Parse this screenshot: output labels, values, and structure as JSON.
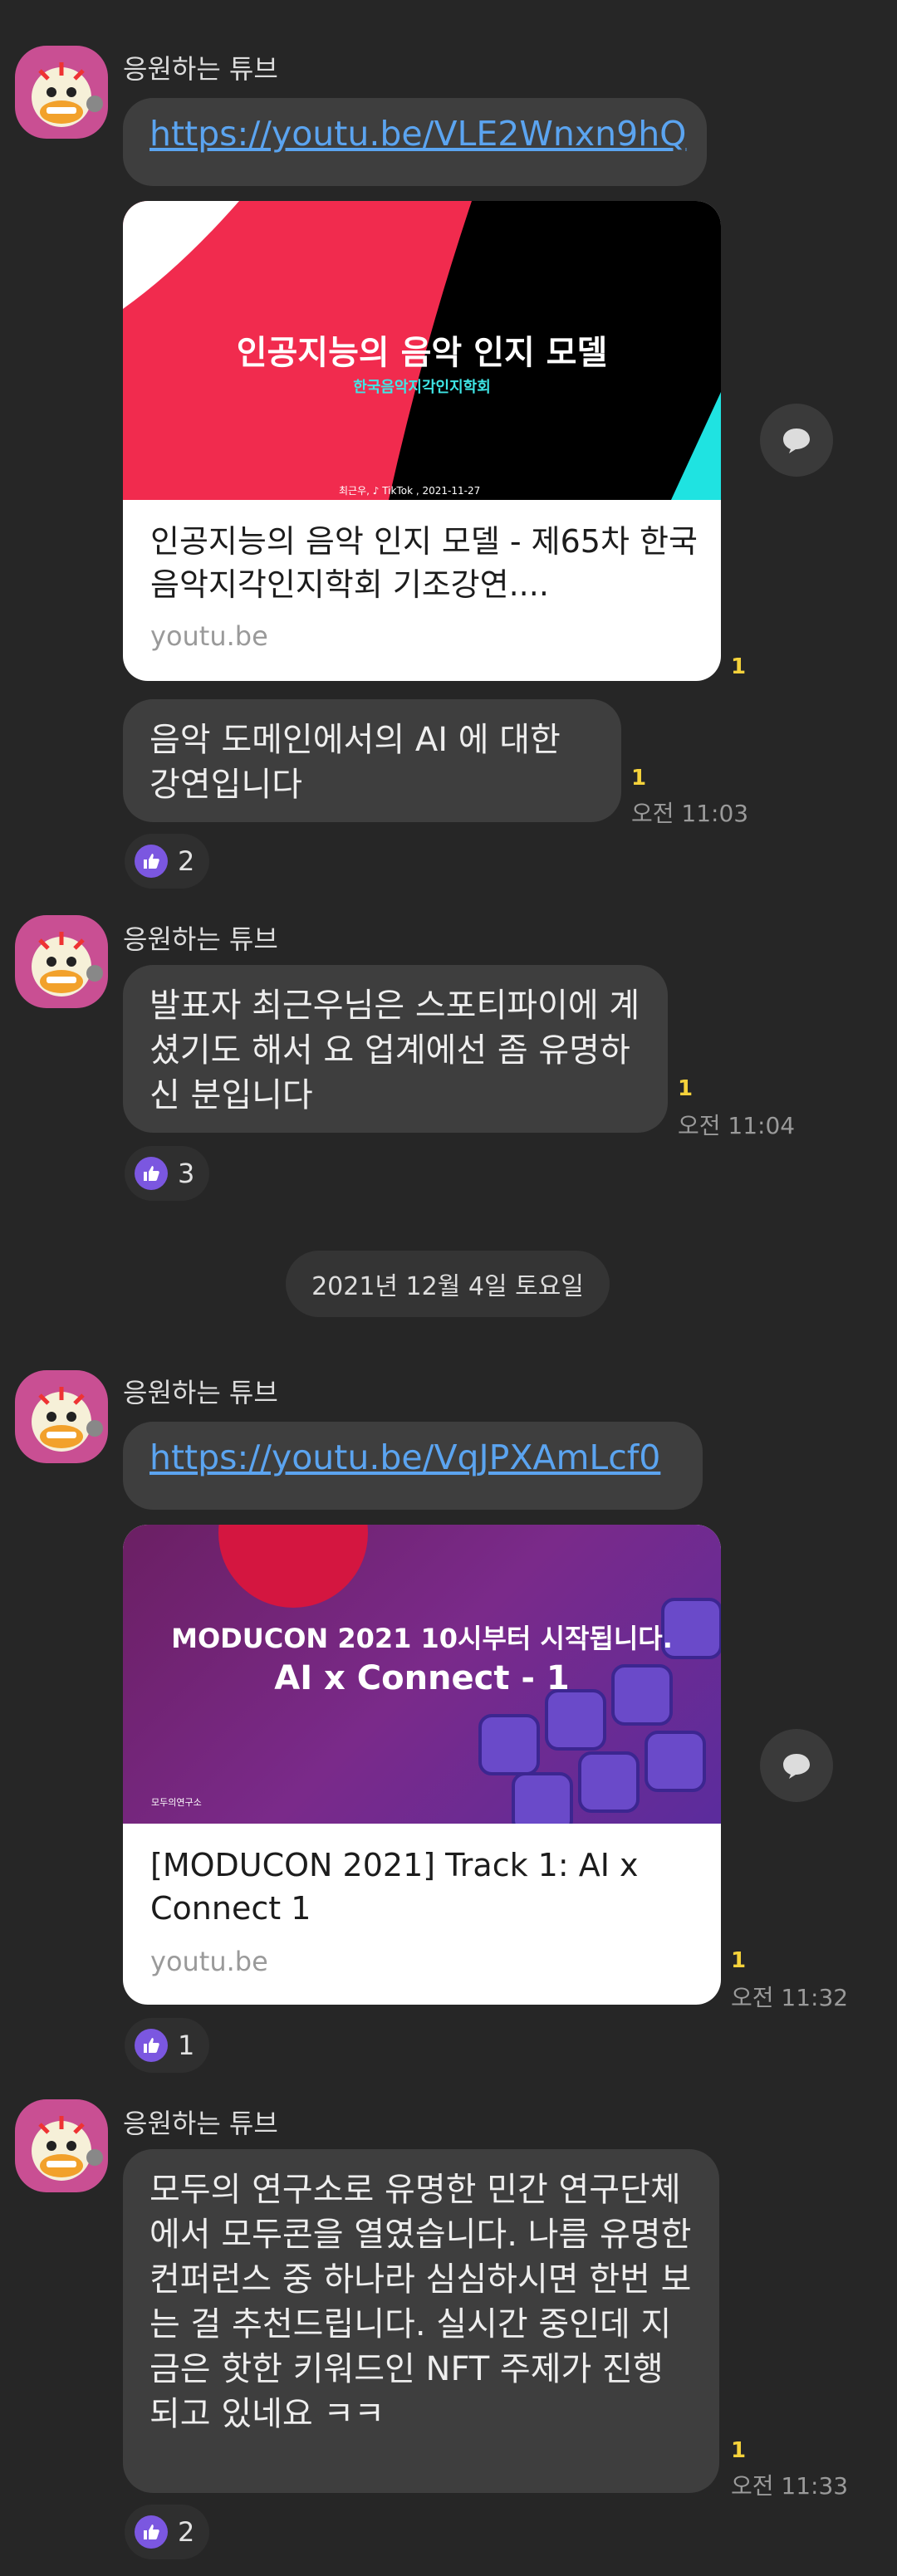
{
  "messages": [
    {
      "sender": "응원하는 튜브",
      "link": "https://youtu.be/VLE2Wnxn9hQ",
      "card": {
        "thumb_title": "인공지능의 음악 인지 모델",
        "thumb_subtitle": "한국음악지각인지학회",
        "thumb_footer": "최근우, ♪ TikTok , 2021-11-27",
        "title": "인공지능의 음악 인지 모델 - 제65차 한국음악지각인지학회 기조강연....",
        "domain": "youtu.be",
        "unread": "1"
      },
      "text": "음악 도메인에서의 AI 에 대한 강연입니다",
      "unread": "1",
      "time": "오전 11:03",
      "reaction": "2"
    },
    {
      "sender": "응원하는 튜브",
      "text": "발표자 최근우님은 스포티파이에 계셨기도 해서 요 업계에선 좀 유명하신 분입니다",
      "unread": "1",
      "time": "오전 11:04",
      "reaction": "3"
    },
    {
      "date_divider": "2021년 12월 4일 토요일"
    },
    {
      "sender": "응원하는 튜브",
      "link": "https://youtu.be/VqJPXAmLcf0",
      "card": {
        "thumb_title": "MODUCON 2021 10시부터 시작됩니다.",
        "thumb_subtitle": "AI x Connect - 1",
        "thumb_logo": "모두의연구소",
        "title": "[MODUCON 2021] Track 1: AI x Connect 1",
        "domain": "youtu.be"
      },
      "unread": "1",
      "time": "오전 11:32",
      "reaction": "1"
    },
    {
      "sender": "응원하는 튜브",
      "text": "모두의 연구소로 유명한 민간 연구단체에서 모두콘을 열였습니다. 나름 유명한 컨퍼런스 중 하나라 심심하시면 한번 보는 걸 추천드립니다. 실시간 중인데 지금은 핫한 키워드인 NFT 주제가 진행되고 있네요 ㅋㅋ",
      "unread": "1",
      "time": "오전 11:33",
      "reaction": "2"
    }
  ],
  "icons": {
    "avatar": "tube-character-avatar",
    "share": "speech-bubble-share-icon",
    "reaction": "thumbs-up-icon"
  },
  "colors": {
    "background": "#262626",
    "bubble": "#3e3e3e",
    "link": "#5ba4f0",
    "unread": "#f5d23b",
    "reaction": "#7b57e0"
  }
}
